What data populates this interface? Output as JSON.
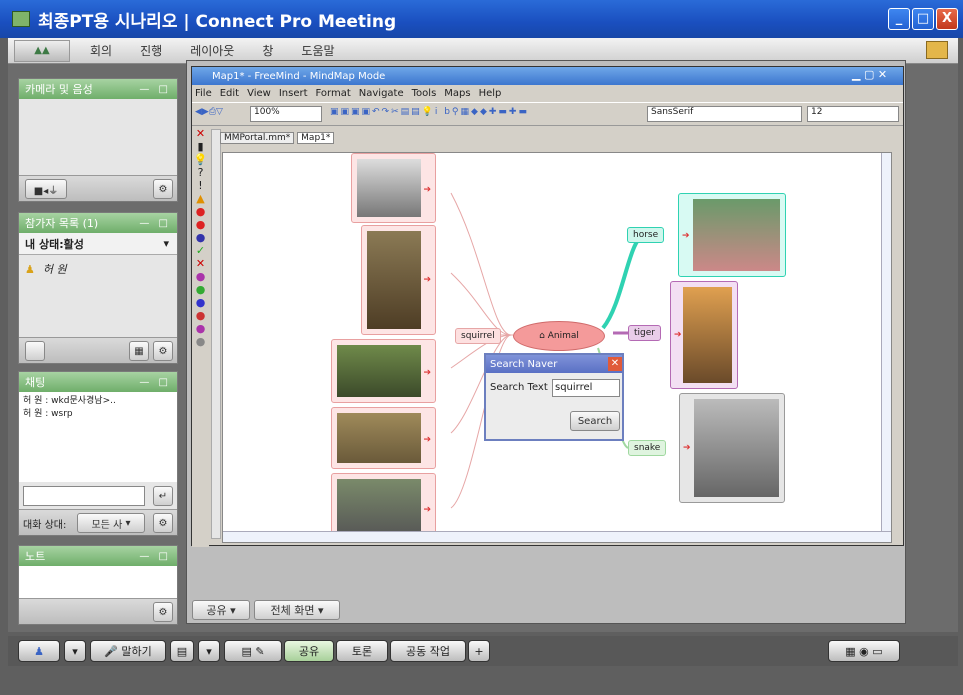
{
  "window": {
    "title": "최종PT용 시나리오 | Connect Pro Meeting",
    "min": "_",
    "max": "□",
    "close": "X"
  },
  "menu": [
    "회의",
    "진행",
    "레이아웃",
    "창",
    "도움말"
  ],
  "pods": {
    "camera": {
      "title": "카메라 및 음성",
      "ctl": "— □"
    },
    "attendees": {
      "title": "참가자 목록 (1)",
      "ctl": "— □",
      "status": "내 상태:활성",
      "user": "허 원"
    },
    "chat": {
      "title": "채팅",
      "ctl": "— □",
      "messages": [
        "허 원 : wkd문사경남>..",
        "허 원 : wsrp"
      ],
      "to_label": "대화 상대:",
      "to_value": "모든 사"
    },
    "notes": {
      "title": "노트",
      "ctl": "— □"
    }
  },
  "freemind": {
    "title": "Map1* - FreeMind - MindMap Mode",
    "menu": [
      "File",
      "Edit",
      "View",
      "Insert",
      "Format",
      "Navigate",
      "Tools",
      "Maps",
      "Help"
    ],
    "zoom": "100%",
    "font": "SansSerif",
    "size": "12",
    "tabs": [
      "MMPortal.mm*",
      "Map1*"
    ],
    "nodes": {
      "center": "Animal",
      "squirrel": "squirrel",
      "horse": "horse",
      "tiger": "tiger",
      "snake": "snake"
    },
    "share": "공유",
    "fullscreen": "전체 화면"
  },
  "search": {
    "title": "Search Naver",
    "label": "Search Text :",
    "value": "squirrel",
    "button": "Search"
  },
  "bottom": {
    "talk": "말하기",
    "share": "공유",
    "discuss": "토론",
    "collab": "공동 작업",
    "add": "+"
  }
}
